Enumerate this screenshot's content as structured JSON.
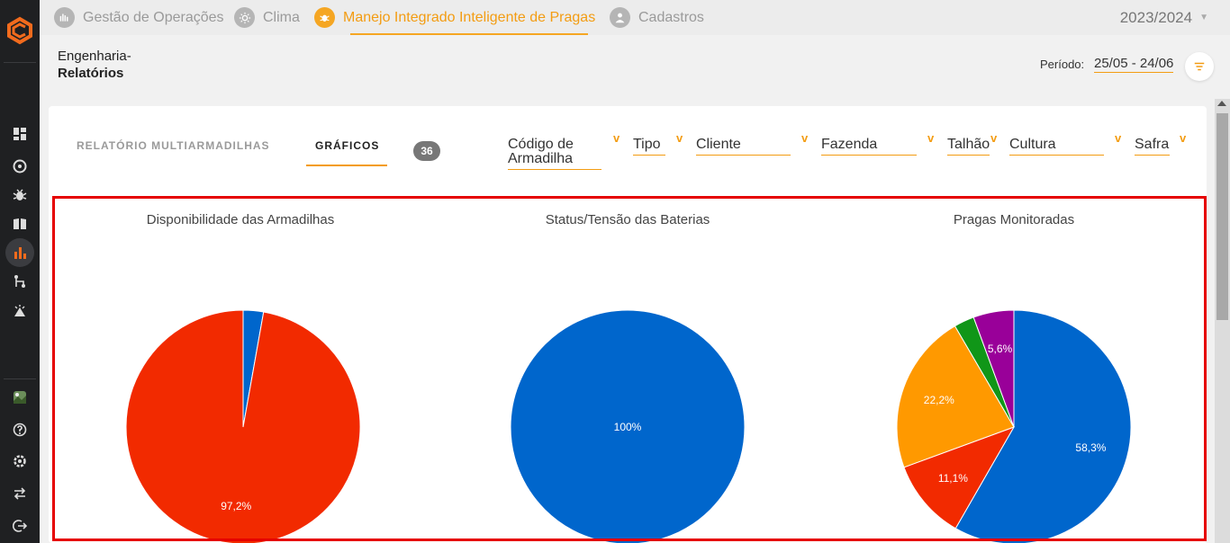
{
  "nav": {
    "items": [
      {
        "label": "Gestão de Operações"
      },
      {
        "label": "Clima"
      },
      {
        "label": "Manejo Integrado Inteligente de Pragas"
      },
      {
        "label": "Cadastros"
      }
    ],
    "season": "2023/2024"
  },
  "breadcrumb": {
    "parent": "Engenharia-",
    "current": "Relatórios"
  },
  "period": {
    "label": "Período:",
    "value": "25/05 - 24/06"
  },
  "tabs": {
    "report": "RELATÓRIO MULTIARMADILHAS",
    "charts": "GRÁFICOS",
    "count": "36"
  },
  "filters": {
    "codigo_line1": "Código de",
    "codigo_line2": "Armadilha",
    "tipo": "Tipo",
    "cliente": "Cliente",
    "fazenda": "Fazenda",
    "talhao": "Talhão",
    "cultura": "Cultura",
    "safra": "Safra",
    "chevron": "v"
  },
  "colors": {
    "accent": "#f39c12",
    "blue": "#0066cc",
    "red": "#f22a00",
    "orange": "#ff9900",
    "green": "#109618",
    "purple": "#990099",
    "highlight": "#e60000"
  },
  "chart_data": [
    {
      "type": "pie",
      "title": "Disponibilidade das Armadilhas",
      "slices": [
        {
          "value": 2.8,
          "color": "#0066cc",
          "label": ""
        },
        {
          "value": 97.2,
          "color": "#f22a00",
          "label": "97,2%"
        }
      ]
    },
    {
      "type": "pie",
      "title": "Status/Tensão das Baterias",
      "slices": [
        {
          "value": 100,
          "color": "#0066cc",
          "label": "100%"
        }
      ]
    },
    {
      "type": "pie",
      "title": "Pragas Monitoradas",
      "slices": [
        {
          "value": 58.3,
          "color": "#0066cc",
          "label": "58,3%"
        },
        {
          "value": 11.1,
          "color": "#f22a00",
          "label": "11,1%"
        },
        {
          "value": 22.2,
          "color": "#ff9900",
          "label": "22,2%"
        },
        {
          "value": 2.8,
          "color": "#109618",
          "label": ""
        },
        {
          "value": 5.6,
          "color": "#990099",
          "label": "5,6%"
        }
      ]
    }
  ]
}
